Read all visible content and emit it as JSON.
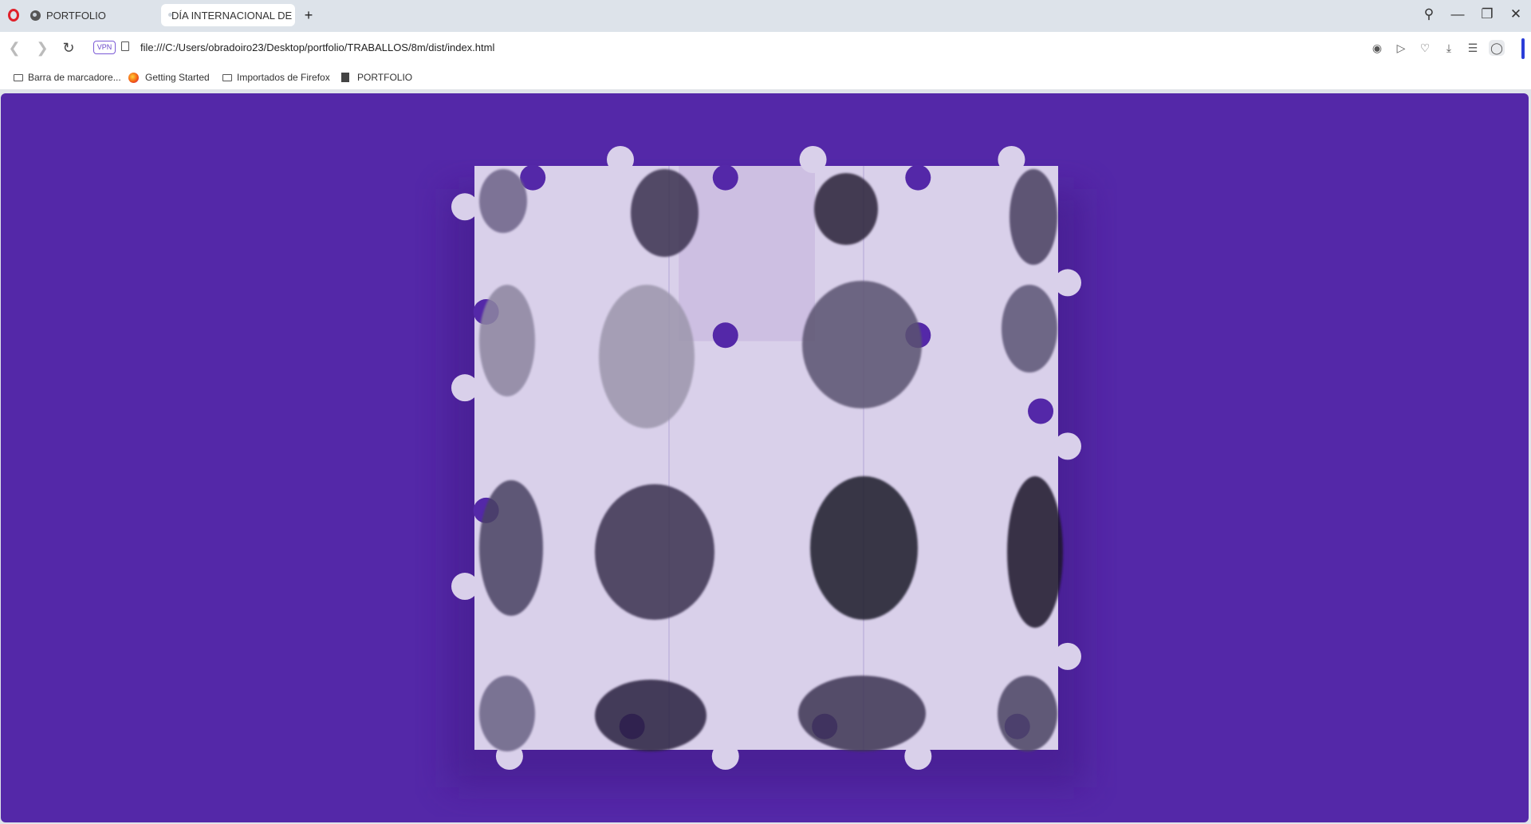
{
  "browser": {
    "tabs": [
      {
        "label": "PORTFOLIO",
        "active": false
      },
      {
        "label": "DÍA INTERNACIONAL DE LA",
        "active": true
      }
    ],
    "new_tab_symbol": "+",
    "window_controls": [
      "search-icon",
      "minimize-icon",
      "restore-icon",
      "close-icon"
    ],
    "address": {
      "vpn_label": "VPN",
      "url": "file:///C:/Users/obradoiro23/Desktop/portfolio/TRABALLOS/8m/dist/index.html"
    },
    "toolbar_icons": [
      "camera-icon",
      "send-icon",
      "heart-icon",
      "download-icon",
      "easy-setup-icon",
      "profile-icon"
    ],
    "bookmarks": [
      {
        "label": "Barra de marcadore...",
        "icon": "folder-icon"
      },
      {
        "label": "Getting Started",
        "icon": "firefox-icon"
      },
      {
        "label": "Importados de Firefox",
        "icon": "folder-icon"
      },
      {
        "label": "PORTFOLIO",
        "icon": "document-icon"
      }
    ]
  },
  "page": {
    "background": "#5428a8",
    "piece_color": "#d9d0ea",
    "puzzle": {
      "rows": 4,
      "cols": 3
    }
  }
}
